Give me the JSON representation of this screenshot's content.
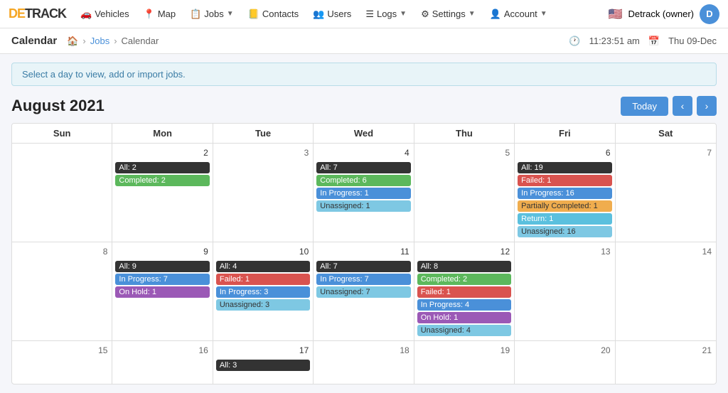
{
  "logo": {
    "de": "DE",
    "track": "TRACK"
  },
  "nav": {
    "items": [
      {
        "id": "vehicles",
        "label": "Vehicles",
        "icon": "🚗",
        "dropdown": false
      },
      {
        "id": "map",
        "label": "Map",
        "icon": "📍",
        "dropdown": false
      },
      {
        "id": "jobs",
        "label": "Jobs",
        "icon": "📋",
        "dropdown": true
      },
      {
        "id": "contacts",
        "label": "Contacts",
        "icon": "📒",
        "dropdown": false
      },
      {
        "id": "users",
        "label": "Users",
        "icon": "👥",
        "dropdown": false
      },
      {
        "id": "logs",
        "label": "Logs",
        "icon": "☰",
        "dropdown": true
      },
      {
        "id": "settings",
        "label": "Settings",
        "icon": "⚙",
        "dropdown": true
      },
      {
        "id": "account",
        "label": "Account",
        "icon": "👤",
        "dropdown": true
      }
    ],
    "user": "Detrack (owner)",
    "avatar_letter": "D"
  },
  "subheader": {
    "page_title": "Calendar",
    "breadcrumb": [
      "Home",
      "Jobs",
      "Calendar"
    ],
    "time": "11:23:51 am",
    "date": "Thu 09-Dec"
  },
  "info_bar": "Select a day to view, add or import jobs.",
  "calendar": {
    "month_year": "August 2021",
    "today_label": "Today",
    "nav_prev": "‹",
    "nav_next": "›",
    "day_names": [
      "Sun",
      "Mon",
      "Tue",
      "Wed",
      "Thu",
      "Fri",
      "Sat"
    ],
    "weeks": [
      {
        "days": [
          {
            "date": "",
            "events": []
          },
          {
            "date": "2",
            "events": [
              {
                "type": "all",
                "label": "All: 2"
              },
              {
                "type": "completed",
                "label": "Completed: 2"
              }
            ]
          },
          {
            "date": "3",
            "events": []
          },
          {
            "date": "4",
            "events": [
              {
                "type": "all",
                "label": "All: 7"
              },
              {
                "type": "completed",
                "label": "Completed: 6"
              },
              {
                "type": "inprogress",
                "label": "In Progress: 1"
              },
              {
                "type": "unassigned",
                "label": "Unassigned: 1"
              }
            ]
          },
          {
            "date": "5",
            "events": []
          },
          {
            "date": "6",
            "events": [
              {
                "type": "all",
                "label": "All: 19"
              },
              {
                "type": "failed",
                "label": "Failed: 1"
              },
              {
                "type": "inprogress",
                "label": "In Progress: 16"
              },
              {
                "type": "partial",
                "label": "Partially Completed: 1"
              },
              {
                "type": "return",
                "label": "Return: 1"
              },
              {
                "type": "unassigned",
                "label": "Unassigned: 16"
              }
            ]
          },
          {
            "date": "7",
            "events": []
          }
        ]
      },
      {
        "days": [
          {
            "date": "8",
            "events": []
          },
          {
            "date": "9",
            "events": [
              {
                "type": "all",
                "label": "All: 9"
              },
              {
                "type": "inprogress",
                "label": "In Progress: 7"
              },
              {
                "type": "onhold",
                "label": "On Hold: 1"
              }
            ]
          },
          {
            "date": "10",
            "events": [
              {
                "type": "all",
                "label": "All: 4"
              },
              {
                "type": "failed",
                "label": "Failed: 1"
              },
              {
                "type": "inprogress",
                "label": "In Progress: 3"
              },
              {
                "type": "unassigned",
                "label": "Unassigned: 3"
              }
            ]
          },
          {
            "date": "11",
            "events": [
              {
                "type": "all",
                "label": "All: 7"
              },
              {
                "type": "inprogress",
                "label": "In Progress: 7"
              },
              {
                "type": "unassigned",
                "label": "Unassigned: 7"
              }
            ]
          },
          {
            "date": "12",
            "events": [
              {
                "type": "all",
                "label": "All: 8"
              },
              {
                "type": "completed",
                "label": "Completed: 2"
              },
              {
                "type": "failed",
                "label": "Failed: 1"
              },
              {
                "type": "inprogress",
                "label": "In Progress: 4"
              },
              {
                "type": "onhold",
                "label": "On Hold: 1"
              },
              {
                "type": "unassigned",
                "label": "Unassigned: 4"
              }
            ]
          },
          {
            "date": "13",
            "events": []
          },
          {
            "date": "14",
            "events": []
          }
        ]
      },
      {
        "days": [
          {
            "date": "15",
            "events": []
          },
          {
            "date": "16",
            "events": []
          },
          {
            "date": "17",
            "events": [
              {
                "type": "all",
                "label": "All: 3"
              }
            ]
          },
          {
            "date": "18",
            "events": []
          },
          {
            "date": "19",
            "events": []
          },
          {
            "date": "20",
            "events": []
          },
          {
            "date": "21",
            "events": []
          }
        ]
      }
    ]
  }
}
